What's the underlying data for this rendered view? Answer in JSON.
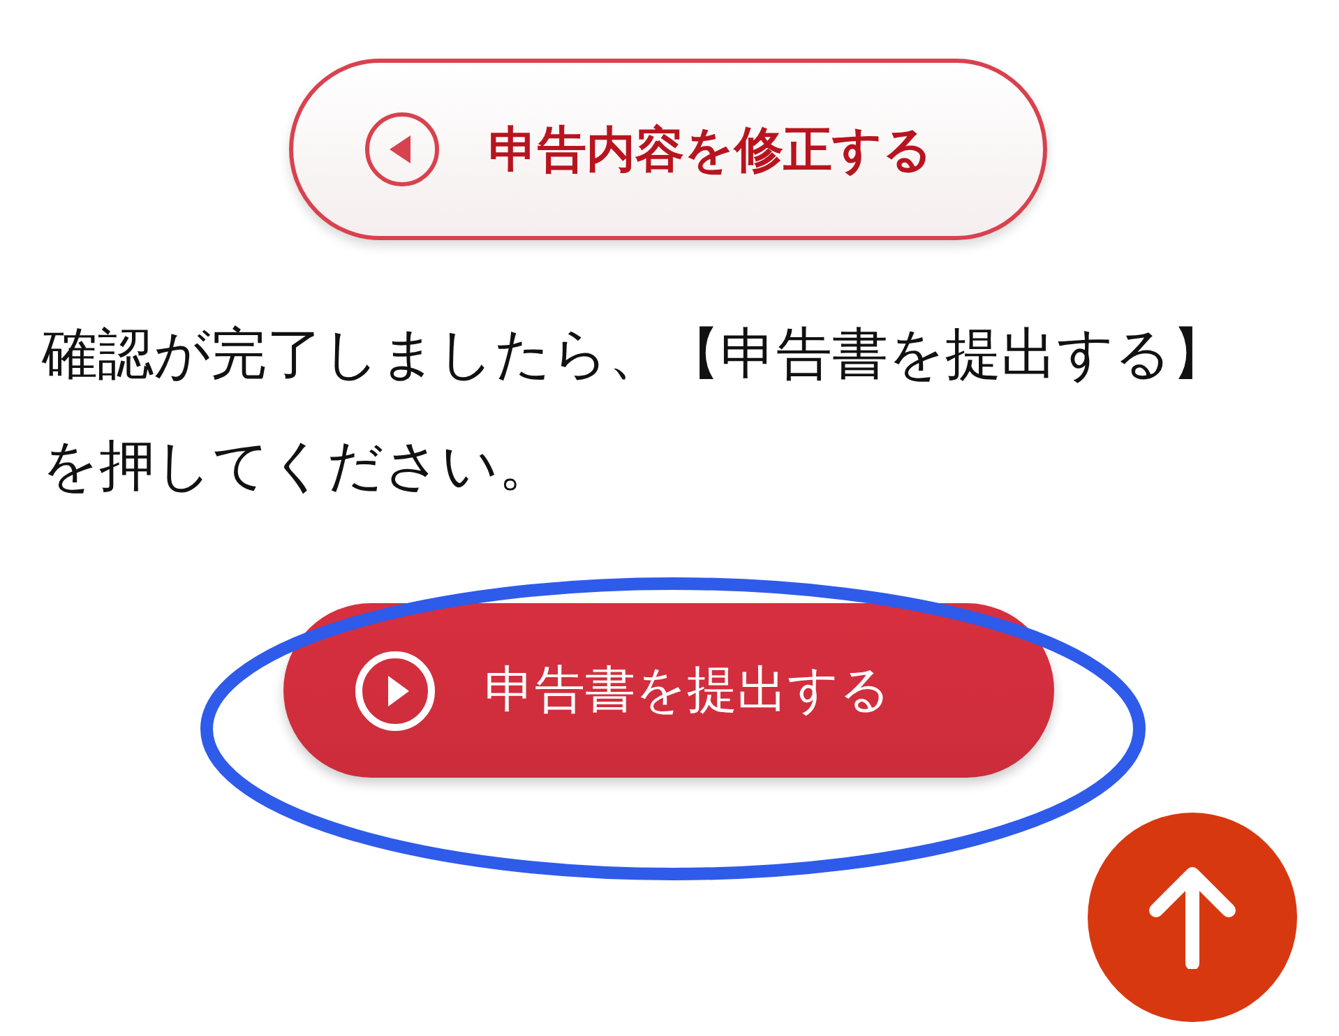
{
  "edit_button": {
    "label": "申告内容を修正する"
  },
  "instruction": {
    "text": "確認が完了しましたら、【申告書を提出する】を押してください。"
  },
  "submit_button": {
    "label": "申告書を提出する"
  }
}
